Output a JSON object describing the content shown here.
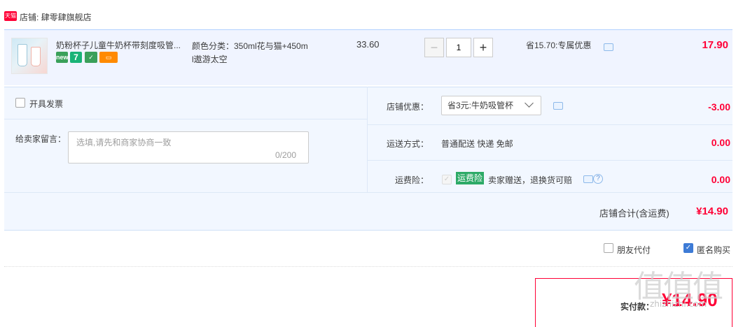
{
  "shop": {
    "badge": "天猫",
    "label": "店铺: 肆零肆旗舰店"
  },
  "item": {
    "title": "奶粉杯子儿童牛奶杯带刻度吸管...",
    "tags": [
      "new",
      "7",
      "",
      ""
    ],
    "spec_line1": "颜色分类：350ml花与猫+450m",
    "spec_line2": "l遨游太空",
    "price": "33.60",
    "qty_minus": "−",
    "qty_value": "1",
    "qty_plus": "+",
    "discount": "省15.70:专属优惠",
    "subtotal": "17.90"
  },
  "invoice": {
    "label": "开具发票"
  },
  "message": {
    "label": "给卖家留言：",
    "placeholder": "选填,请先和商家协商一致",
    "count": "0/200"
  },
  "coupon": {
    "label": "店铺优惠：",
    "selected": "省3元:牛奶吸管杯",
    "value": "-3.00"
  },
  "shipping": {
    "label": "运送方式：",
    "text": "普通配送 快递 免邮",
    "value": "0.00"
  },
  "insurance": {
    "label": "运费险：",
    "badge": "运费险",
    "text": "卖家赠送，退换货可赔",
    "value": "0.00"
  },
  "shop_total": {
    "label": "店铺合计(含运费)",
    "value": "¥14.90"
  },
  "options": {
    "friend_pay": "朋友代付",
    "anonymous": "匿名购买"
  },
  "payment": {
    "label": "实付款：",
    "amount": "¥14.90"
  },
  "watermark": {
    "text": "值值值",
    "sub": "zhizhizhi.com"
  },
  "colors": {
    "accent": "#ff0036",
    "row_bg": "#f0f4ff",
    "panel_bg": "#f2f7ff",
    "insurance_green": "#2daa67"
  }
}
